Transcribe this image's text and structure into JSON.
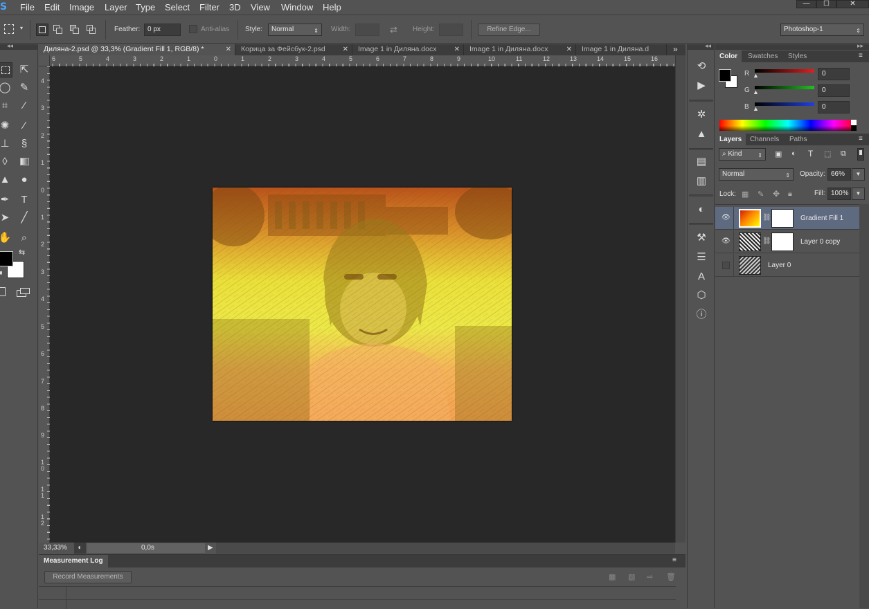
{
  "app": {
    "logo": "S"
  },
  "menu": [
    "File",
    "Edit",
    "Image",
    "Layer",
    "Type",
    "Select",
    "Filter",
    "3D",
    "View",
    "Window",
    "Help"
  ],
  "window_controls": {
    "minimize": "—",
    "maximize": "☐",
    "close": "✕"
  },
  "options": {
    "feather_label": "Feather:",
    "feather_value": "0 px",
    "antialias_label": "Anti-alias",
    "style_label": "Style:",
    "style_value": "Normal",
    "width_label": "Width:",
    "height_label": "Height:",
    "refine_edge": "Refine Edge...",
    "workspace": "Photoshop-1"
  },
  "tabs": [
    {
      "label": "Диляна-2.psd @ 33,3% (Gradient Fill 1, RGB/8) *",
      "active": true
    },
    {
      "label": "Корица за Фейсбук-2.psd",
      "active": false
    },
    {
      "label": "Image 1 in Диляна.docx",
      "active": false
    },
    {
      "label": "Image 1 in Диляна.docx",
      "active": false
    },
    {
      "label": "Image 1 in Диляна.d",
      "active": false
    }
  ],
  "tabs_overflow": "»",
  "ruler_top": [
    "6",
    "5",
    "4",
    "3",
    "2",
    "1",
    "0",
    "1",
    "2",
    "3",
    "4",
    "5",
    "6",
    "7",
    "8",
    "9",
    "10",
    "11",
    "12",
    "13",
    "14",
    "15",
    "16"
  ],
  "ruler_left": [
    "4",
    "3",
    "2",
    "1",
    "0",
    "1",
    "2",
    "3",
    "4",
    "5",
    "6",
    "7",
    "8",
    "9",
    "1 0",
    "1 1",
    "1 2"
  ],
  "status": {
    "zoom": "33,33%",
    "timing": "0,0s"
  },
  "measurement_log": {
    "title": "Measurement Log",
    "record_button": "Record Measurements"
  },
  "color_panel": {
    "tabs": [
      "Color",
      "Swatches",
      "Styles"
    ],
    "channels": [
      {
        "name": "R",
        "value": "0",
        "color": "#e02020"
      },
      {
        "name": "G",
        "value": "0",
        "color": "#20c020"
      },
      {
        "name": "B",
        "value": "0",
        "color": "#2040e0"
      }
    ]
  },
  "layers_panel": {
    "tabs": [
      "Layers",
      "Channels",
      "Paths"
    ],
    "filter_kind": "Kind",
    "blend_mode": "Normal",
    "opacity_label": "Opacity:",
    "opacity_value": "66%",
    "lock_label": "Lock:",
    "fill_label": "Fill:",
    "fill_value": "100%",
    "layers": [
      {
        "name": "Gradient Fill 1",
        "visible": true,
        "selected": true
      },
      {
        "name": "Layer 0 copy",
        "visible": true,
        "selected": false
      },
      {
        "name": "Layer 0",
        "visible": false,
        "selected": false
      }
    ]
  },
  "accent_colors": {
    "selected_layer": "#5e6a80",
    "gradient_top": "#c2561a",
    "gradient_mid": "#eeea3a",
    "gradient_bottom": "#f59a48"
  }
}
